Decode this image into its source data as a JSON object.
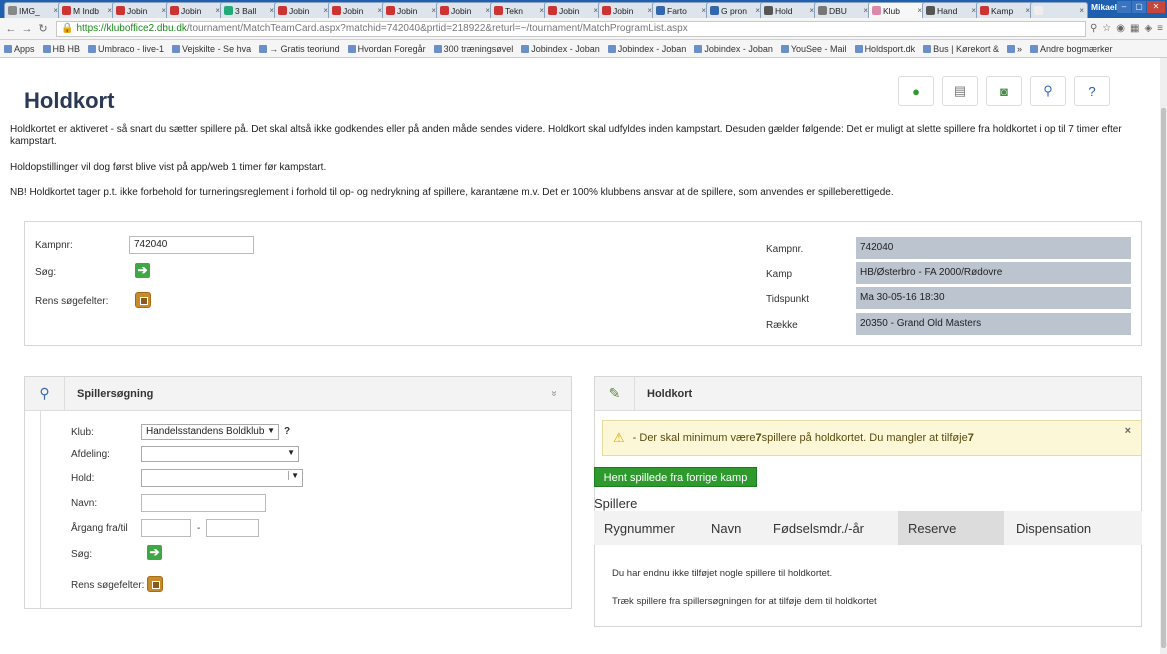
{
  "browser": {
    "tabs": [
      "IMG_",
      "M Indb",
      "Jobin",
      "Jobin",
      "3 Ball",
      "Jobin",
      "Jobin",
      "Jobin",
      "Jobin",
      "Tekn",
      "Jobin",
      "Jobin",
      "Farto",
      "G pron",
      "Hold",
      "DBU",
      "Klub",
      "Hand",
      "Kamp",
      ""
    ],
    "active_tab_index": 16,
    "user": "Mikael",
    "url_host": "https://kluboffice2.dbu.dk",
    "url_path": "/tournament/MatchTeamCard.aspx?matchid=742040&prtid=218922&returl=~/tournament/MatchProgramList.aspx",
    "bookmarks": [
      "Apps",
      "HB HB",
      "Umbraco - live-1",
      "Vejskilte - Se hva",
      "→ Gratis teoriund",
      "Hvordan Foregår",
      "300 træningsøvel",
      "Jobindex - Joban",
      "Jobindex - Joban",
      "Jobindex - Joban",
      "YouSee - Mail",
      "Holdsport.dk",
      "Bus | Kørekort &",
      "»",
      "Andre bogmærker"
    ]
  },
  "page": {
    "title": "Holdkort",
    "intro1": "Holdkortet er aktiveret - så snart du sætter spillere på. Det skal altså ikke godkendes eller på anden måde sendes videre. Holdkort skal udfyldes inden kampstart. Desuden gælder følgende: Det er muligt at slette spillere fra holdkortet i op til 7 timer efter kampstart.",
    "intro2": "Holdopstillinger vil dog først blive vist på app/web 1 timer før kampstart.",
    "intro3": "NB! Holdkortet tager p.t. ikke forbehold for turneringsreglement i forhold til op- og nedrykning af spillere, karantæne m.v. Det er 100% klubbens ansvar at de spillere, som anvendes er spilleberettigede."
  },
  "search_form": {
    "kampnr_label": "Kampnr:",
    "kampnr_value": "742040",
    "sog_label": "Søg:",
    "rens_label": "Rens søgefelter:"
  },
  "match_info": {
    "rows": [
      {
        "label": "Kampnr.",
        "value": "742040"
      },
      {
        "label": "Kamp",
        "value": "HB/Østerbro - FA 2000/Rødovre"
      },
      {
        "label": "Tidspunkt",
        "value": "Ma 30-05-16 18:30"
      },
      {
        "label": "Række",
        "value": "20350 - Grand Old Masters"
      }
    ]
  },
  "player_search": {
    "title": "Spillersøgning",
    "collapse": "»",
    "klub_label": "Klub:",
    "klub_value": "Handelsstandens Boldklub",
    "afdeling_label": "Afdeling:",
    "hold_label": "Hold:",
    "navn_label": "Navn:",
    "aargang_label": "Årgang fra/til",
    "dash": "-",
    "sog_label": "Søg:",
    "rens_label": "Rens søgefelter:"
  },
  "holdkort": {
    "title": "Holdkort",
    "alert_pre": " - Der skal minimum være ",
    "alert_num": "7",
    "alert_mid": " spillere på holdkortet. Du mangler at tilføje ",
    "alert_num2": "7",
    "close": "×",
    "fetch_button": "Hent spillede fra forrige kamp",
    "players_heading": "Spillere",
    "columns": [
      "Rygnummer",
      "Navn",
      "Fødselsmdr./-år",
      "Reserve",
      "Dispensation"
    ],
    "empty1": "Du har endnu ikke tilføjet nogle spillere til holdkortet.",
    "empty2": "Træk spillere fra spillersøgningen for at tilføje dem til holdkortet"
  },
  "colors": {
    "accent_green": "#2e9a2e",
    "title": "#2a3a55",
    "info_bg": "#bcc4cf",
    "alert_bg": "#fcf8d7"
  }
}
